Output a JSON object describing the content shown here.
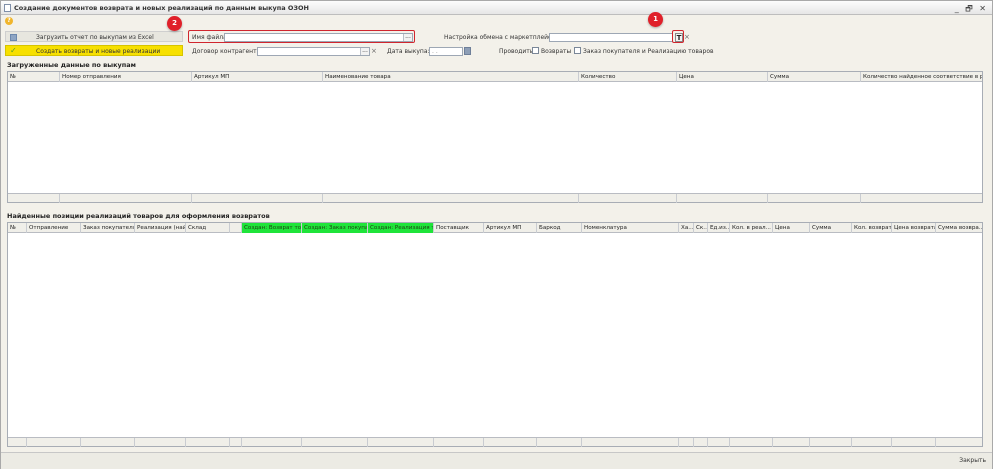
{
  "window": {
    "title": "Создание документов возврата и новых реализаций по данным выкупа ОЗОН",
    "controls": "_ 🗗 ✕"
  },
  "help_icon": "?",
  "commands": {
    "load_excel": "Загрузить отчет по выкупам из Excel",
    "create": "Создать возвраты и новые реализации"
  },
  "form": {
    "file_name_label": "Имя файла:",
    "file_name_value": "",
    "ellipsis": "...",
    "contract_label": "Договор контрагента:",
    "contract_value": "",
    "date_label": "Дата выкупа:",
    "date_value": " .  .    ",
    "exchange_label": "Настройка обмена с маркетплейсом:",
    "exchange_value": "",
    "t_button": "T",
    "clear": "×",
    "post_label": "Проводить:",
    "returns_label": "Возвраты",
    "orders_label": "Заказ покупателя и Реализацию товаров"
  },
  "callouts": [
    "1",
    "2"
  ],
  "sections": {
    "uploaded": "Загруженные данные по выкупам",
    "found": "Найденные позиции реализаций товаров для оформления возвратов"
  },
  "table1": {
    "columns": [
      "№",
      "Номер отправления",
      "Артикул МП",
      "Наименование товара",
      "Количество",
      "Цена",
      "Сумма",
      "Количество найденное соответствие в реа..."
    ]
  },
  "table2": {
    "columns": [
      "№",
      "Отправление",
      "Заказ покупателя",
      "Реализация (най...",
      "Склад",
      "",
      "Создан: Возврат то...",
      "Создан: Заказ покупа...",
      "Создан: Реализация т...",
      "Поставщик",
      "Артикул МП",
      "Баркод",
      "Номенклатура",
      "Ха...",
      "Ск...",
      "Ед.из...",
      "Кол. в реал...",
      "Цена",
      "Сумма",
      "Кол. возврат",
      "Цена возврата",
      "Сумма возвра..."
    ]
  },
  "footer": {
    "close": "Закрыть"
  },
  "colors": {
    "highlight": "#d0262e",
    "create_button": "#f7e000",
    "green_columns": "#1fe43a"
  }
}
